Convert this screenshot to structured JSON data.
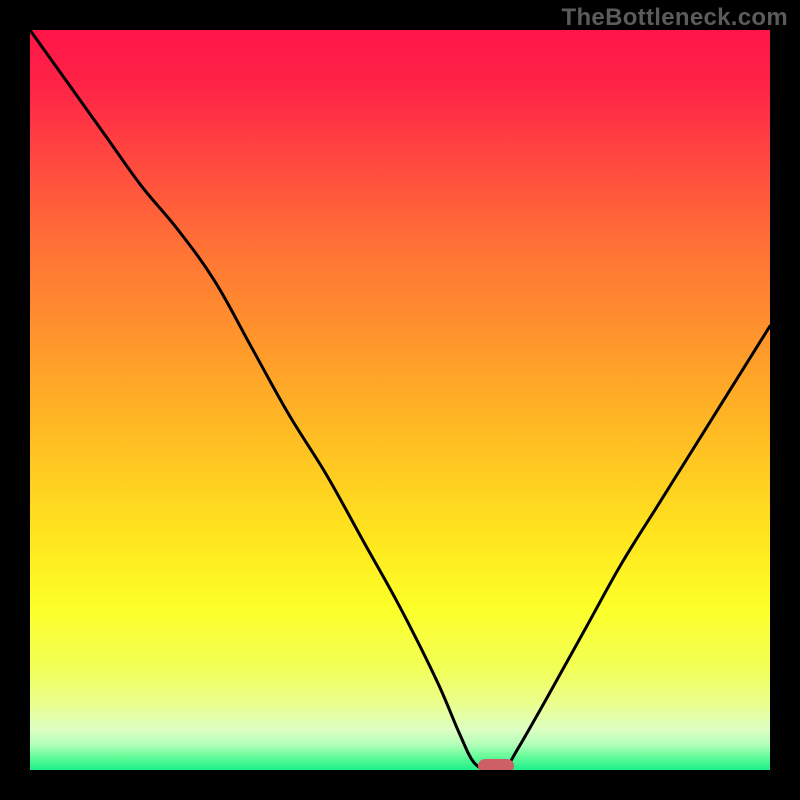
{
  "watermark": "TheBottleneck.com",
  "chart_data": {
    "type": "line",
    "title": "",
    "xlabel": "",
    "ylabel": "",
    "xlim": [
      0,
      100
    ],
    "ylim": [
      0,
      100
    ],
    "x": [
      0,
      5,
      10,
      15,
      20,
      25,
      30,
      35,
      40,
      45,
      50,
      55,
      58,
      60,
      62,
      64,
      66,
      70,
      75,
      80,
      85,
      90,
      95,
      100
    ],
    "values": [
      100,
      93,
      86,
      79,
      73,
      66,
      57,
      48,
      40,
      31,
      22,
      12,
      5,
      1,
      0,
      0,
      3,
      10,
      19,
      28,
      36,
      44,
      52,
      60
    ],
    "marker": {
      "x": 63,
      "y": 0.5,
      "color": "#ce5f66"
    },
    "gradient_stops": [
      {
        "offset": 0.0,
        "color": "#ff1448"
      },
      {
        "offset": 0.08,
        "color": "#ff2546"
      },
      {
        "offset": 0.18,
        "color": "#ff4a3f"
      },
      {
        "offset": 0.3,
        "color": "#ff7435"
      },
      {
        "offset": 0.42,
        "color": "#ff962c"
      },
      {
        "offset": 0.55,
        "color": "#ffbd23"
      },
      {
        "offset": 0.68,
        "color": "#ffe41e"
      },
      {
        "offset": 0.78,
        "color": "#fcff28"
      },
      {
        "offset": 0.86,
        "color": "#f2ff55"
      },
      {
        "offset": 0.91,
        "color": "#eaff8e"
      },
      {
        "offset": 0.945,
        "color": "#ddffc2"
      },
      {
        "offset": 0.965,
        "color": "#b4ffb9"
      },
      {
        "offset": 0.98,
        "color": "#6efc9c"
      },
      {
        "offset": 1.0,
        "color": "#1cf08a"
      }
    ]
  }
}
